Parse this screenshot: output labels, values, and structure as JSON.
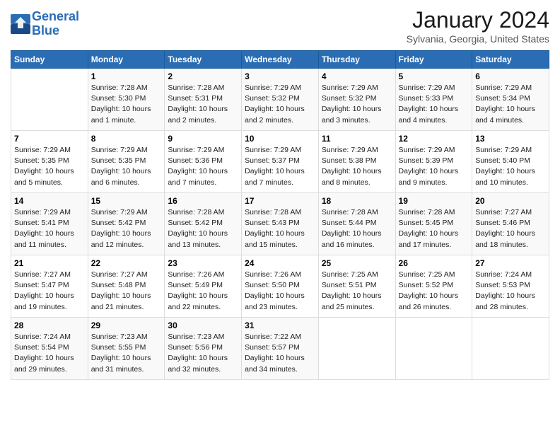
{
  "header": {
    "logo_line1": "General",
    "logo_line2": "Blue",
    "month": "January 2024",
    "location": "Sylvania, Georgia, United States"
  },
  "weekdays": [
    "Sunday",
    "Monday",
    "Tuesday",
    "Wednesday",
    "Thursday",
    "Friday",
    "Saturday"
  ],
  "weeks": [
    [
      {
        "num": "",
        "info": ""
      },
      {
        "num": "1",
        "info": "Sunrise: 7:28 AM\nSunset: 5:30 PM\nDaylight: 10 hours\nand 1 minute."
      },
      {
        "num": "2",
        "info": "Sunrise: 7:28 AM\nSunset: 5:31 PM\nDaylight: 10 hours\nand 2 minutes."
      },
      {
        "num": "3",
        "info": "Sunrise: 7:29 AM\nSunset: 5:32 PM\nDaylight: 10 hours\nand 2 minutes."
      },
      {
        "num": "4",
        "info": "Sunrise: 7:29 AM\nSunset: 5:32 PM\nDaylight: 10 hours\nand 3 minutes."
      },
      {
        "num": "5",
        "info": "Sunrise: 7:29 AM\nSunset: 5:33 PM\nDaylight: 10 hours\nand 4 minutes."
      },
      {
        "num": "6",
        "info": "Sunrise: 7:29 AM\nSunset: 5:34 PM\nDaylight: 10 hours\nand 4 minutes."
      }
    ],
    [
      {
        "num": "7",
        "info": "Sunrise: 7:29 AM\nSunset: 5:35 PM\nDaylight: 10 hours\nand 5 minutes."
      },
      {
        "num": "8",
        "info": "Sunrise: 7:29 AM\nSunset: 5:35 PM\nDaylight: 10 hours\nand 6 minutes."
      },
      {
        "num": "9",
        "info": "Sunrise: 7:29 AM\nSunset: 5:36 PM\nDaylight: 10 hours\nand 7 minutes."
      },
      {
        "num": "10",
        "info": "Sunrise: 7:29 AM\nSunset: 5:37 PM\nDaylight: 10 hours\nand 7 minutes."
      },
      {
        "num": "11",
        "info": "Sunrise: 7:29 AM\nSunset: 5:38 PM\nDaylight: 10 hours\nand 8 minutes."
      },
      {
        "num": "12",
        "info": "Sunrise: 7:29 AM\nSunset: 5:39 PM\nDaylight: 10 hours\nand 9 minutes."
      },
      {
        "num": "13",
        "info": "Sunrise: 7:29 AM\nSunset: 5:40 PM\nDaylight: 10 hours\nand 10 minutes."
      }
    ],
    [
      {
        "num": "14",
        "info": "Sunrise: 7:29 AM\nSunset: 5:41 PM\nDaylight: 10 hours\nand 11 minutes."
      },
      {
        "num": "15",
        "info": "Sunrise: 7:29 AM\nSunset: 5:42 PM\nDaylight: 10 hours\nand 12 minutes."
      },
      {
        "num": "16",
        "info": "Sunrise: 7:28 AM\nSunset: 5:42 PM\nDaylight: 10 hours\nand 13 minutes."
      },
      {
        "num": "17",
        "info": "Sunrise: 7:28 AM\nSunset: 5:43 PM\nDaylight: 10 hours\nand 15 minutes."
      },
      {
        "num": "18",
        "info": "Sunrise: 7:28 AM\nSunset: 5:44 PM\nDaylight: 10 hours\nand 16 minutes."
      },
      {
        "num": "19",
        "info": "Sunrise: 7:28 AM\nSunset: 5:45 PM\nDaylight: 10 hours\nand 17 minutes."
      },
      {
        "num": "20",
        "info": "Sunrise: 7:27 AM\nSunset: 5:46 PM\nDaylight: 10 hours\nand 18 minutes."
      }
    ],
    [
      {
        "num": "21",
        "info": "Sunrise: 7:27 AM\nSunset: 5:47 PM\nDaylight: 10 hours\nand 19 minutes."
      },
      {
        "num": "22",
        "info": "Sunrise: 7:27 AM\nSunset: 5:48 PM\nDaylight: 10 hours\nand 21 minutes."
      },
      {
        "num": "23",
        "info": "Sunrise: 7:26 AM\nSunset: 5:49 PM\nDaylight: 10 hours\nand 22 minutes."
      },
      {
        "num": "24",
        "info": "Sunrise: 7:26 AM\nSunset: 5:50 PM\nDaylight: 10 hours\nand 23 minutes."
      },
      {
        "num": "25",
        "info": "Sunrise: 7:25 AM\nSunset: 5:51 PM\nDaylight: 10 hours\nand 25 minutes."
      },
      {
        "num": "26",
        "info": "Sunrise: 7:25 AM\nSunset: 5:52 PM\nDaylight: 10 hours\nand 26 minutes."
      },
      {
        "num": "27",
        "info": "Sunrise: 7:24 AM\nSunset: 5:53 PM\nDaylight: 10 hours\nand 28 minutes."
      }
    ],
    [
      {
        "num": "28",
        "info": "Sunrise: 7:24 AM\nSunset: 5:54 PM\nDaylight: 10 hours\nand 29 minutes."
      },
      {
        "num": "29",
        "info": "Sunrise: 7:23 AM\nSunset: 5:55 PM\nDaylight: 10 hours\nand 31 minutes."
      },
      {
        "num": "30",
        "info": "Sunrise: 7:23 AM\nSunset: 5:56 PM\nDaylight: 10 hours\nand 32 minutes."
      },
      {
        "num": "31",
        "info": "Sunrise: 7:22 AM\nSunset: 5:57 PM\nDaylight: 10 hours\nand 34 minutes."
      },
      {
        "num": "",
        "info": ""
      },
      {
        "num": "",
        "info": ""
      },
      {
        "num": "",
        "info": ""
      }
    ]
  ]
}
